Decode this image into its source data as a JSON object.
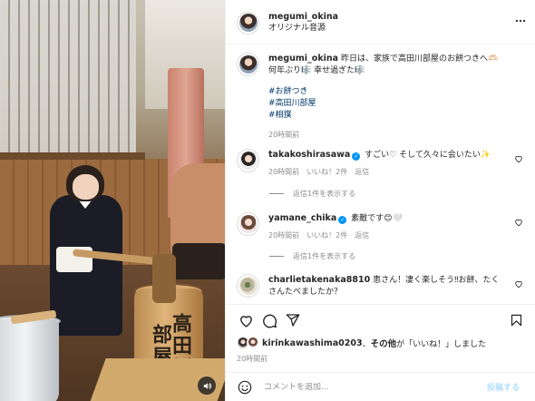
{
  "post": {
    "username": "megumi_okina",
    "audio": "オリジナル音源",
    "caption_text": "昨日は、家族で高田川部屋のお餅つきへ🫶🏻",
    "caption_line2": "何年ぶり🎼 幸せ過ぎた🎼",
    "hashtags": [
      "#お餅つき",
      "#高田川部屋",
      "#相撲"
    ],
    "time": "20時間前"
  },
  "media": {
    "mortar_text": "高田川部屋"
  },
  "comments": [
    {
      "username": "takakoshirasawa",
      "verified": true,
      "text": "すごい♡ そして久々に会いたい✨",
      "time": "20時間前",
      "likes": "いいね！2件",
      "reply": "返信",
      "view_replies": "返信1件を表示する"
    },
    {
      "username": "yamane_chika",
      "verified": true,
      "text": "素敵です😊🤍",
      "time": "20時間前",
      "likes": "いいね！2件",
      "reply": "返信",
      "view_replies": "返信1件を表示する"
    },
    {
      "username": "charlietakenaka8810",
      "verified": false,
      "text": "恵さん！凄く楽しそう‼︎お餅、たくさんたべましたか？"
    }
  ],
  "likes": {
    "username": "kirinkawashima0203",
    "joiner": "、",
    "others": "その他",
    "suffix": "が「いいね！」しました"
  },
  "compose": {
    "placeholder": "コメントを追加...",
    "post_label": "投稿する"
  },
  "icons": {
    "more": "more-horizontal-icon",
    "like": "heart-icon",
    "comment": "comment-bubble-icon",
    "share": "paper-plane-icon",
    "save": "bookmark-icon",
    "emoji": "emoji-smile-icon",
    "sound": "speaker-icon",
    "verified": "verified-badge-icon"
  },
  "colors": {
    "link": "#00376b",
    "verified": "#0095f6",
    "muted": "#8e8e8e",
    "post_button": "#b2dffc"
  }
}
